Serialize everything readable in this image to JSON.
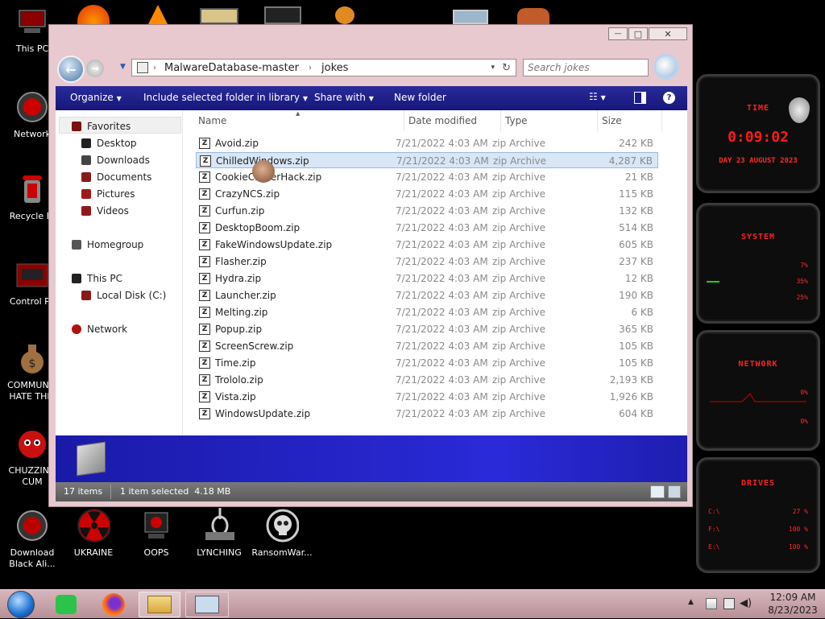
{
  "desktop": {
    "left_icons": [
      {
        "label": "This PC"
      },
      {
        "label": "Network"
      },
      {
        "label": "Recycle Bi"
      },
      {
        "label": "Control Pa"
      },
      {
        "label": "COMMUNIS\nHATE THIS"
      },
      {
        "label": "CHUZZING\nCUM"
      },
      {
        "label": "Download\nBlack Ali..."
      }
    ],
    "bottom_icons": [
      {
        "label": "UKRAINE"
      },
      {
        "label": "OOPS"
      },
      {
        "label": "LYNCHING"
      },
      {
        "label": "RansomWar..."
      }
    ]
  },
  "gadget": {
    "time_title": "TIME",
    "clock": "0:09:02",
    "date": "DAY 23 AUGUST 2023",
    "system_title": "SYSTEM",
    "system_values": [
      "7%",
      "35%",
      "25%"
    ],
    "network_title": "NETWORK",
    "network_values": [
      "0%",
      "0%"
    ],
    "drives_title": "DRIVES",
    "drives": [
      {
        "letter": "C:\\",
        "value": "27 %"
      },
      {
        "letter": "F:\\",
        "value": "100 %"
      },
      {
        "letter": "E:\\",
        "value": "100 %"
      }
    ]
  },
  "window": {
    "caption_min": "—",
    "caption_max": "□",
    "caption_close": "✕",
    "breadcrumb": [
      "MalwareDatabase-master",
      "jokes"
    ],
    "search_placeholder": "Search jokes",
    "toolbar": {
      "organize": "Organize",
      "include": "Include selected folder in library",
      "share": "Share with",
      "new_folder": "New folder"
    },
    "nav": {
      "favorites": "Favorites",
      "desktop": "Desktop",
      "downloads": "Downloads",
      "documents": "Documents",
      "pictures": "Pictures",
      "videos": "Videos",
      "homegroup": "Homegroup",
      "this_pc": "This PC",
      "local_disk": "Local Disk (C:)",
      "network": "Network"
    },
    "columns": {
      "name": "Name",
      "date": "Date modified",
      "type": "Type",
      "size": "Size"
    },
    "files": [
      {
        "name": "Avoid.zip",
        "date": "7/21/2022 4:03 AM",
        "type": "zip Archive",
        "size": "242 KB"
      },
      {
        "name": "ChilledWindows.zip",
        "date": "7/21/2022 4:03 AM",
        "type": "zip Archive",
        "size": "4,287 KB"
      },
      {
        "name": "CookieClickerHack.zip",
        "date": "7/21/2022 4:03 AM",
        "type": "zip Archive",
        "size": "21 KB"
      },
      {
        "name": "CrazyNCS.zip",
        "date": "7/21/2022 4:03 AM",
        "type": "zip Archive",
        "size": "115 KB"
      },
      {
        "name": "Curfun.zip",
        "date": "7/21/2022 4:03 AM",
        "type": "zip Archive",
        "size": "132 KB"
      },
      {
        "name": "DesktopBoom.zip",
        "date": "7/21/2022 4:03 AM",
        "type": "zip Archive",
        "size": "514 KB"
      },
      {
        "name": "FakeWindowsUpdate.zip",
        "date": "7/21/2022 4:03 AM",
        "type": "zip Archive",
        "size": "605 KB"
      },
      {
        "name": "Flasher.zip",
        "date": "7/21/2022 4:03 AM",
        "type": "zip Archive",
        "size": "237 KB"
      },
      {
        "name": "Hydra.zip",
        "date": "7/21/2022 4:03 AM",
        "type": "zip Archive",
        "size": "12 KB"
      },
      {
        "name": "Launcher.zip",
        "date": "7/21/2022 4:03 AM",
        "type": "zip Archive",
        "size": "190 KB"
      },
      {
        "name": "Melting.zip",
        "date": "7/21/2022 4:03 AM",
        "type": "zip Archive",
        "size": "6 KB"
      },
      {
        "name": "Popup.zip",
        "date": "7/21/2022 4:03 AM",
        "type": "zip Archive",
        "size": "365 KB"
      },
      {
        "name": "ScreenScrew.zip",
        "date": "7/21/2022 4:03 AM",
        "type": "zip Archive",
        "size": "105 KB"
      },
      {
        "name": "Time.zip",
        "date": "7/21/2022 4:03 AM",
        "type": "zip Archive",
        "size": "105 KB"
      },
      {
        "name": "Trololo.zip",
        "date": "7/21/2022 4:03 AM",
        "type": "zip Archive",
        "size": "2,193 KB"
      },
      {
        "name": "Vista.zip",
        "date": "7/21/2022 4:03 AM",
        "type": "zip Archive",
        "size": "1,926 KB"
      },
      {
        "name": "WindowsUpdate.zip",
        "date": "7/21/2022 4:03 AM",
        "type": "zip Archive",
        "size": "604 KB"
      }
    ],
    "status": {
      "count": "17 items",
      "selection": "1 item selected  4.18 MB"
    }
  },
  "taskbar": {
    "time": "12:09 AM",
    "date": "8/23/2023"
  },
  "colors": {
    "toolbar": "#1c1c88",
    "selection": "#d8e6f6",
    "window_frame": "#e7c9cf",
    "gadget_red": "#ff2020"
  }
}
